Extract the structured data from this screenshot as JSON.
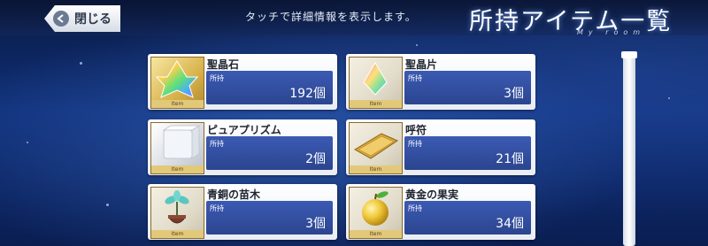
{
  "header": {
    "close_label": "閉じる",
    "hint": "タッチで詳細情報を表示します。",
    "title": "所持アイテム一覧",
    "subtitle": "My room"
  },
  "quantity_label": "所持",
  "items": [
    {
      "name": "聖晶石",
      "quantity": "192個",
      "thumb_label": "Item"
    },
    {
      "name": "聖晶片",
      "quantity": "3個",
      "thumb_label": "Item"
    },
    {
      "name": "ピュアプリズム",
      "quantity": "2個",
      "thumb_label": "Item"
    },
    {
      "name": "呼符",
      "quantity": "21個",
      "thumb_label": "Item"
    },
    {
      "name": "青銅の苗木",
      "quantity": "3個",
      "thumb_label": "Item"
    },
    {
      "name": "黄金の果実",
      "quantity": "34個",
      "thumb_label": "Item"
    }
  ],
  "icons": [
    "back-arrow-icon",
    "saint-quartz-icon",
    "quartz-fragment-icon",
    "pure-prism-icon",
    "summon-ticket-icon",
    "bronze-sapling-icon",
    "golden-fruit-icon"
  ]
}
